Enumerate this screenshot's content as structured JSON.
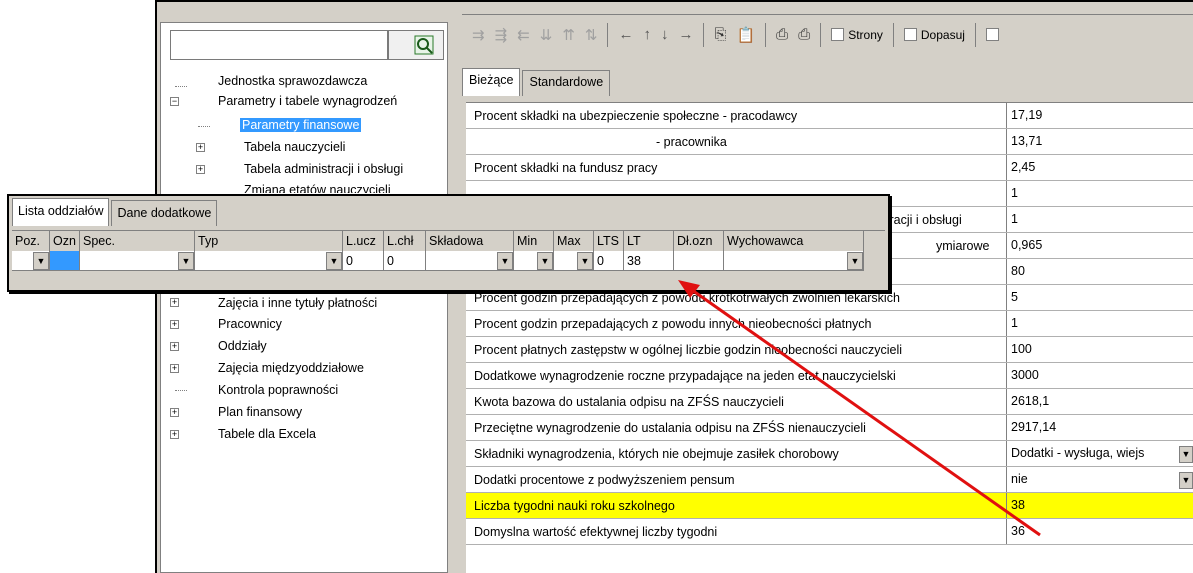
{
  "toolbar": {
    "strony": "Strony",
    "dopasuj": "Dopasuj"
  },
  "tree": {
    "top": [
      "Jednostka sprawozdawcza",
      "Parametry i tabele wynagrodzeń",
      "Parametry finansowe",
      "Tabela nauczycieli",
      "Tabela administracji i obsługi",
      "Zmiana etatów nauczycieli"
    ],
    "bottom": [
      "Zajęcia i inne tytuły płatności",
      "Pracownicy",
      "Oddziały",
      "Zajęcia międzyoddziałowe",
      "Kontrola poprawności",
      "Plan finansowy",
      "Tabele dla Excela"
    ]
  },
  "tabs": [
    "Bieżące",
    "Standardowe"
  ],
  "grid": [
    {
      "label": "Procent składki na ubezpieczenie społeczne - pracodawcy",
      "value": "17,19"
    },
    {
      "label": "- pracownika",
      "value": "13,71"
    },
    {
      "label": "Procent składki na fundusz pracy",
      "value": "2,45"
    },
    {
      "label": "",
      "value": "1"
    },
    {
      "label": "tracji i obsługi",
      "value": "1"
    },
    {
      "label": "ymiarowe",
      "value": "0,965"
    },
    {
      "label": "",
      "value": "80"
    },
    {
      "label": "Procent godzin przepadających z powodu krótkotrwałych zwolnień lekarskich",
      "value": "5"
    },
    {
      "label": "Procent godzin przepadających z powodu innych nieobecności płatnych",
      "value": "1"
    },
    {
      "label": "Procent płatnych zastępstw w ogólnej liczbie godzin nieobecności nauczycieli",
      "value": "100"
    },
    {
      "label": "Dodatkowe wynagrodzenie roczne przypadające na jeden etat nauczycielski",
      "value": "3000"
    },
    {
      "label": "Kwota bazowa do ustalania odpisu na ZFŚS nauczycieli",
      "value": "2618,1"
    },
    {
      "label": "Przeciętne wynagrodzenie do ustalania odpisu na ZFŚS nienauczycieli",
      "value": "2917,14"
    },
    {
      "label": "Składniki wynagrodzenia, których nie obejmuje zasiłek chorobowy",
      "value": "Dodatki - wysługa, wiejs"
    },
    {
      "label": "Dodatki procentowe z podwyższeniem pensum",
      "value": "nie"
    },
    {
      "label": "Liczba tygodni nauki roku szkolnego",
      "value": "38"
    },
    {
      "label": "Domyslna wartość efektywnej liczby tygodni",
      "value": "36"
    }
  ],
  "popup": {
    "tabs": [
      "Lista oddziałów",
      "Dane dodatkowe"
    ],
    "headers": [
      "Poz.",
      "Ozn",
      "Spec.",
      "Typ",
      "L.ucz",
      "L.chł",
      "Składowa",
      "Min",
      "Max",
      "LTS",
      "LT",
      "Dł.ozn",
      "Wychowawca"
    ],
    "row": {
      "lucz": "0",
      "lchl": "0",
      "lts": "0",
      "lt": "38"
    }
  }
}
